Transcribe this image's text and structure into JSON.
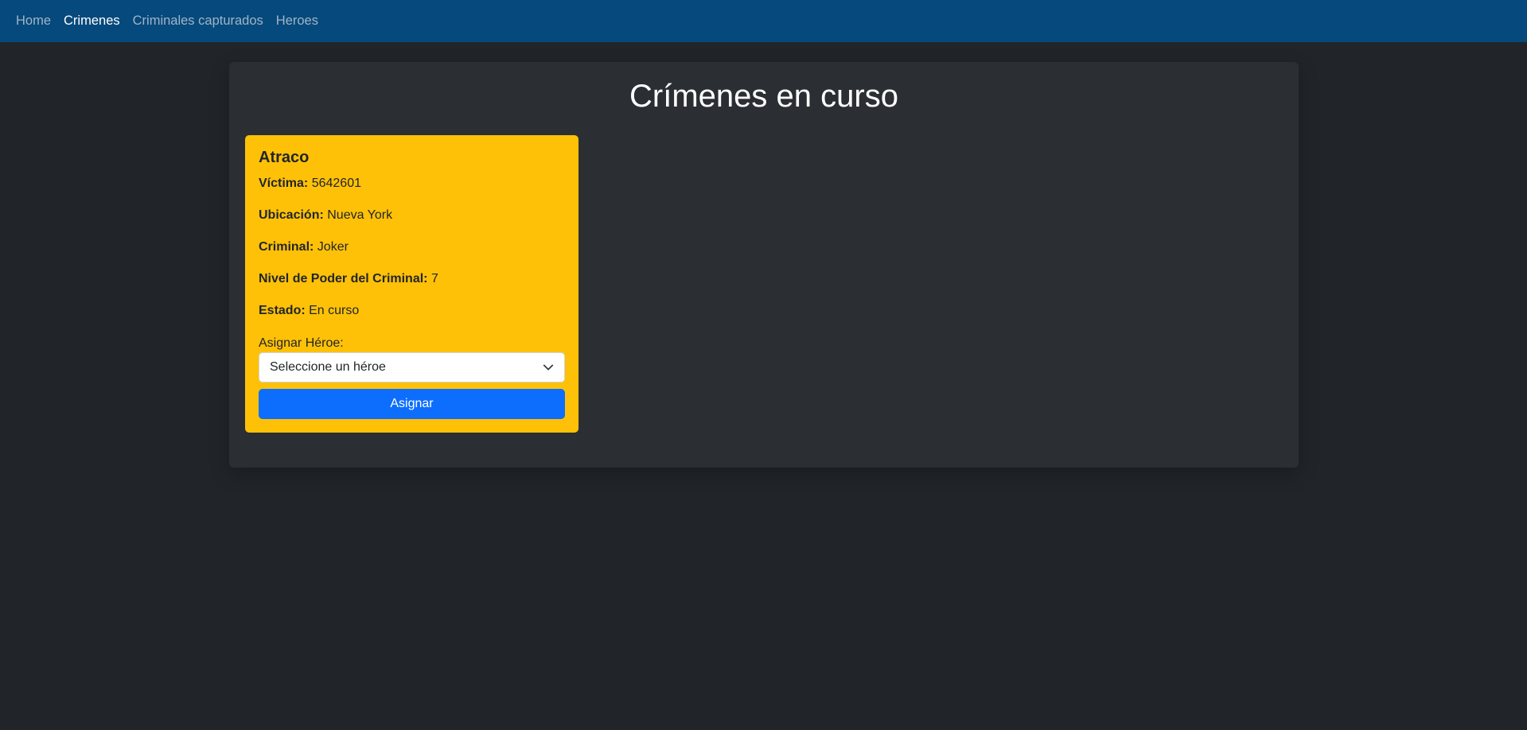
{
  "nav": {
    "items": [
      {
        "label": "Home",
        "active": false
      },
      {
        "label": "Crimenes",
        "active": true
      },
      {
        "label": "Criminales capturados",
        "active": false
      },
      {
        "label": "Heroes",
        "active": false
      }
    ]
  },
  "page": {
    "title": "Crímenes en curso"
  },
  "crime": {
    "title": "Atraco",
    "victim_label": "Víctima:",
    "victim_value": "5642601",
    "location_label": "Ubicación:",
    "location_value": "Nueva York",
    "criminal_label": "Criminal:",
    "criminal_value": "Joker",
    "power_label": "Nivel de Poder del Criminal:",
    "power_value": "7",
    "status_label": "Estado:",
    "status_value": "En curso",
    "assign_label": "Asignar Héroe:",
    "select_value": "Seleccione un héroe",
    "assign_button": "Asignar"
  },
  "colors": {
    "navbar": "#06497c",
    "background": "#212529",
    "panel": "#2b2e33",
    "card": "#ffc107",
    "button": "#0d6efd"
  }
}
